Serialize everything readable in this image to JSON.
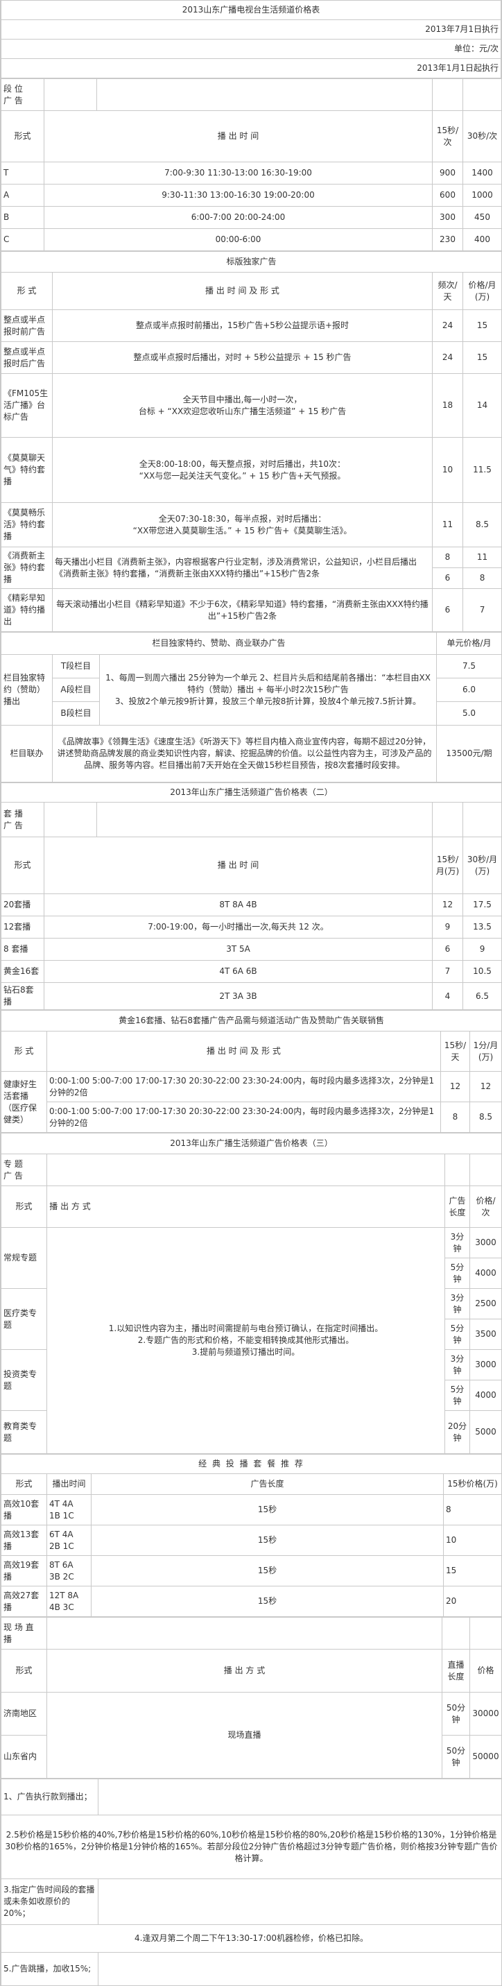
{
  "header": {
    "title": "2013山东广播电视台生活频道价格表",
    "effective": "2013年7月1日执行",
    "unit": "单位：元/次",
    "start": "2013年1月1日起执行"
  },
  "t1": {
    "corner": "段 位\n广 告",
    "h_form": "形式",
    "h_time": "播 出 时 间",
    "h_15": "15秒/次",
    "h_30": "30秒/次",
    "rows": [
      {
        "form": "T",
        "time": "7:00-9:30 11:30-13:00  16:30-19:00",
        "p15": "900",
        "p30": "1400"
      },
      {
        "form": "A",
        "time": "9:30-11:30 13:00-16:30  19:00-20:00",
        "p15": "600",
        "p30": "1000"
      },
      {
        "form": "B",
        "time": "6:00-7:00 20:00-24:00",
        "p15": "300",
        "p30": "450"
      },
      {
        "form": "C",
        "time": "00:00-6:00",
        "p15": "230",
        "p30": "400"
      }
    ]
  },
  "t2": {
    "title": "标版独家广告",
    "h_form": "形 式",
    "h_time": "播 出 时 间 及 形 式",
    "h_freq": "频次/天",
    "h_price": "价格/月(万)",
    "rows": [
      {
        "form": "整点或半点报时前广告",
        "desc": "整点或半点报时前播出，15秒广告+5秒公益提示语+报时",
        "freq": "24",
        "price": "15"
      },
      {
        "form": "整点或半点报时后广告",
        "desc": "整点或半点报时后播出，对时 + 5秒公益提示 +  15 秒广告",
        "freq": "24",
        "price": "15"
      },
      {
        "form": "《FM105生活广播》台标广告",
        "desc": "全天节目中播出,每一小时一次，\n台标 + “XX欢迎您收听山东广播生活频道” +  15 秒广告",
        "freq": "18",
        "price": "14"
      },
      {
        "form": "《莫莫聊天气》特约套播",
        "desc": "全天8:00-18:00，每天整点报，对时后播出，共10次：\n“XX与您一起关注天气变化。” + 15 秒广告+天气预报。",
        "freq": "10",
        "price": "11.5"
      },
      {
        "form": "《莫莫畅乐活》特约套播",
        "desc": "全天07:30-18:30，每半点报，对时后播出：\n“XX带您进入莫莫聊生活。” + 15 秒广告+《莫莫聊生活》。",
        "freq": "11",
        "price": "8.5"
      },
      {
        "form": "《消费新主张》特约套播",
        "desc": "每天播出小栏目《消费新主张》，内容根据客户行业定制，涉及消费常识，公益知识，小栏目后播出《消费新主张》特约套播，“消费新主张由XXX特约播出”+15秒广告2条",
        "freq": "8",
        "price": "11"
      },
      {
        "form": "",
        "desc": "",
        "freq": "6",
        "price": "8"
      },
      {
        "form": "《精彩早知道》特约播出",
        "desc": "每天滚动播出小栏目《精彩早知道》不少于6次，《精彩早知道》特约套播，“消费新主张由XXX特约播出”+15秒广告2条",
        "freq": "6",
        "price": "7"
      }
    ]
  },
  "t3": {
    "title": "栏目独家特约、赞助、商业联办广告",
    "h_price": "单元价格/月",
    "rowhead": "栏目独家特约（赞助）播出",
    "levels": [
      {
        "name": "T段栏目",
        "price": "7.5"
      },
      {
        "name": "A段栏目",
        "price": "6.0"
      },
      {
        "name": "B段栏目",
        "price": "5.0"
      }
    ],
    "desc": "1、每周一到周六播出 25分钟为一个单元 2、栏目片头后和结尾前各播出：“本栏目由XX特约（赞助）播出 + 每半小时2次15秒广告\n3、投放2个单元按9折计算，投放三个单元按8折计算，投放4个单元按7.5折计算。",
    "joint_head": "栏目联办",
    "joint_desc": "《品牌故事》《领舞生活》《速度生活》《听游天下》等栏目内植入商业宣传内容，每期不超过20分钟，讲述赞助商品牌发展的商业类知识性内容，解读、挖掘品牌的价值。以公益性内容为主，可涉及产品的品牌、服务等内容。栏目播出前7天开始在全天做15秒栏目预告，按8次套播时段安排。",
    "joint_price": "13500元/期"
  },
  "t4": {
    "title": "2013年山东广播生活频道广告价格表（二）",
    "corner": "套 播\n广 告",
    "h_form": "形式",
    "h_time": "播 出 时 间",
    "h_15": "15秒/月(万)",
    "h_30": "30秒/月(万)",
    "rows": [
      {
        "form": "20套播",
        "time": "8T 8A 4B",
        "p15": "12",
        "p30": "17.5"
      },
      {
        "form": "12套播",
        "time": "7:00-19:00，每一小时播出一次,每天共 12 次。",
        "p15": "9",
        "p30": "13.5"
      },
      {
        "form": "8 套播",
        "time": "3T 5A",
        "p15": "6",
        "p30": "9"
      },
      {
        "form": "黄金16套",
        "time": "4T 6A 6B",
        "p15": "7",
        "p30": "10.5"
      },
      {
        "form": "钻石8套播",
        "time": "2T 3A 3B",
        "p15": "4",
        "p30": "6.5"
      }
    ]
  },
  "t5": {
    "title": "黄金16套播、钻石8套播广告产品需与频道活动广告及赞助广告关联销售",
    "h_form": "形 式",
    "h_time": "播 出 时 间 及 形 式",
    "h_15": "15秒/天",
    "h_1m": "1分/月(万)",
    "rowhead": "健康好生活套播（医疗保健类）",
    "rows": [
      {
        "time": "0:00-1:00  5:00-7:00 17:00-17:30 20:30-22:00 23:30-24:00内，每时段内最多选择3次，2分钟是1分钟的2倍",
        "p15": "12",
        "p1m": "12"
      },
      {
        "time": "0:00-1:00  5:00-7:00 17:00-17:30 20:30-22:00 23:30-24:00内，每时段内最多选择3次，2分钟是1分钟的2倍",
        "p15": "8",
        "p1m": "8.5"
      }
    ]
  },
  "t6": {
    "title": "2013年山东广播生活频道广告价格表（三）",
    "corner": "专 题\n广 告",
    "h_form": "形式",
    "h_mode": "播 出 方 式",
    "h_len": "广告长度",
    "h_price": "价格/次",
    "desc": "1.以知识性内容为主，播出时间需提前与电台预订确认，在指定时间播出。\n2.专题广告的形式和价格，不能变相转换成其他形式播出。\n3.提前与频道预订播出时间。",
    "groups": [
      {
        "name": "常规专题",
        "items": [
          {
            "len": "3分钟",
            "price": "3000"
          },
          {
            "len": "5分钟",
            "price": "4000"
          }
        ]
      },
      {
        "name": "医疗类专题",
        "items": [
          {
            "len": "3分钟",
            "price": "2500"
          },
          {
            "len": "5分钟",
            "price": "3500"
          }
        ]
      },
      {
        "name": "投资类专题",
        "items": [
          {
            "len": "3分钟",
            "price": "3000"
          },
          {
            "len": "5分钟",
            "price": "4000"
          }
        ]
      },
      {
        "name": "教育类专题",
        "items": [
          {
            "len": "20分钟",
            "price": "5000"
          }
        ]
      }
    ]
  },
  "t7": {
    "title": "经 典 投 播 套 餐 推 荐",
    "h_form": "形式",
    "h_time": "播出时间",
    "h_len": "广告长度",
    "h_price": "15秒价格(万)",
    "rows": [
      {
        "form": "高效10套播",
        "time": "4T  4A\n1B  1C",
        "len": "15秒",
        "price": "8"
      },
      {
        "form": "高效13套播",
        "time": "6T  4A\n2B  1C",
        "len": "15秒",
        "price": "10"
      },
      {
        "form": "高效19套播",
        "time": "8T  6A\n3B  2C",
        "len": "15秒",
        "price": "15"
      },
      {
        "form": "高效27套播",
        "time": "12T  8A\n4B 3C",
        "len": "15秒",
        "price": "20"
      }
    ]
  },
  "t8": {
    "corner": "现 场 直\n播",
    "h_form": "形式",
    "h_mode": "播 出 方 式",
    "h_len": "直播长度",
    "h_price": "价格",
    "mode": "现场直播",
    "rows": [
      {
        "form": "济南地区",
        "len": "50分钟",
        "price": "30000"
      },
      {
        "form": "山东省内",
        "len": "50分钟",
        "price": "50000"
      }
    ]
  },
  "notes": {
    "n1": "1、广告执行款到播出；",
    "n2": "2.5秒价格是15秒价格的40%,7秒价格是15秒价格的60%,10秒价格是15秒价格的80%,20秒价格是15秒价格的130%，1分钟价格是30秒价格的165%，2分钟价格是1分钟价格的165%。若部分段位2分钟广告价格超过3分钟专题广告价格，则价格按3分钟专题广告价格计算。",
    "n3": "3.指定广告时间段的套播或未条如收原价的20%；",
    "n4": "4.逢双月第二个周二下午13:30-17:00机器检修，价格已扣除。",
    "n5": "5.广告跳播，加收15%;"
  }
}
